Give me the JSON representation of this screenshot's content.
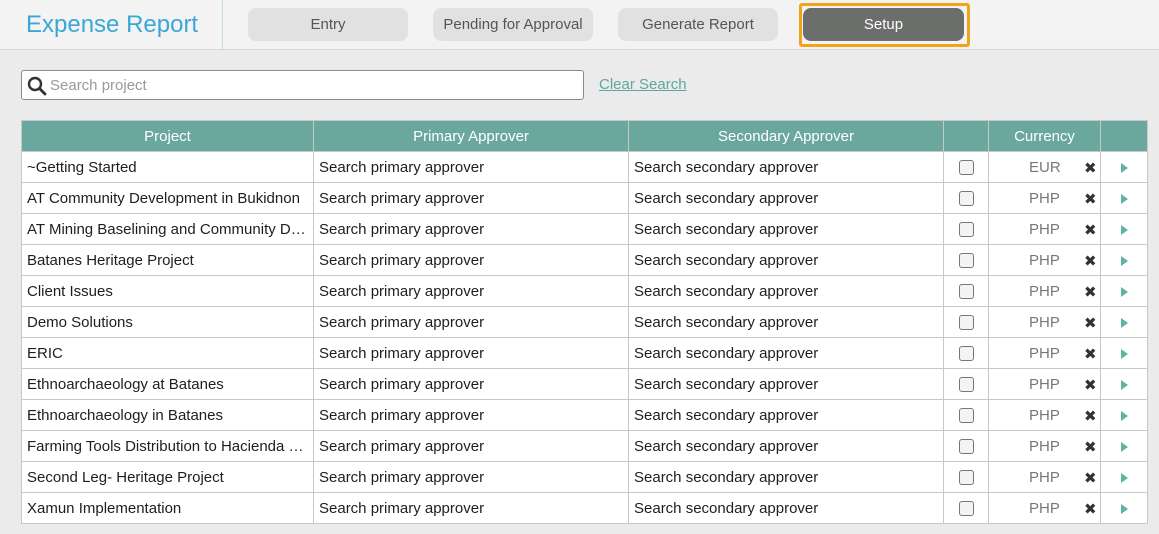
{
  "app": {
    "title": "Expense Report"
  },
  "tabs": [
    {
      "label": "Entry"
    },
    {
      "label": "Pending for Approval"
    },
    {
      "label": "Generate Report"
    },
    {
      "label": "Setup"
    }
  ],
  "search": {
    "placeholder": "Search project",
    "value": "",
    "clear_label": "Clear Search"
  },
  "table": {
    "headers": [
      "Project",
      "Primary Approver",
      "Secondary Approver",
      "",
      "Currency",
      ""
    ],
    "rows": [
      {
        "project": "~Getting Started",
        "primary": "Search primary approver",
        "secondary": "Search secondary approver",
        "currency": "EUR"
      },
      {
        "project": "AT Community Development in Bukidnon",
        "primary": "Search primary approver",
        "secondary": "Search secondary approver",
        "currency": "PHP"
      },
      {
        "project": "AT Mining Baselining and Community Dev...",
        "primary": "Search primary approver",
        "secondary": "Search secondary approver",
        "currency": "PHP"
      },
      {
        "project": "Batanes Heritage Project",
        "primary": "Search primary approver",
        "secondary": "Search secondary approver",
        "currency": "PHP"
      },
      {
        "project": "Client Issues",
        "primary": "Search primary approver",
        "secondary": "Search secondary approver",
        "currency": "PHP"
      },
      {
        "project": "Demo Solutions",
        "primary": "Search primary approver",
        "secondary": "Search secondary approver",
        "currency": "PHP"
      },
      {
        "project": "ERIC",
        "primary": "Search primary approver",
        "secondary": "Search secondary approver",
        "currency": "PHP"
      },
      {
        "project": "Ethnoarchaeology at Batanes",
        "primary": "Search primary approver",
        "secondary": "Search secondary approver",
        "currency": "PHP"
      },
      {
        "project": "Ethnoarchaeology in Batanes",
        "primary": "Search primary approver",
        "secondary": "Search secondary approver",
        "currency": "PHP"
      },
      {
        "project": "Farming Tools Distribution to Hacienda Lui...",
        "primary": "Search primary approver",
        "secondary": "Search secondary approver",
        "currency": "PHP"
      },
      {
        "project": "Second Leg- Heritage Project",
        "primary": "Search primary approver",
        "secondary": "Search secondary approver",
        "currency": "PHP"
      },
      {
        "project": "Xamun Implementation",
        "primary": "Search primary approver",
        "secondary": "Search secondary approver",
        "currency": "PHP"
      }
    ]
  },
  "icons": {
    "search": "search-icon",
    "remove": "close-icon",
    "expand": "chevron-right-icon"
  },
  "colors": {
    "accent": "#6aa89f",
    "title": "#3aa7d6",
    "active_tab": "#6b6e6b",
    "focus": "#f0a418"
  }
}
